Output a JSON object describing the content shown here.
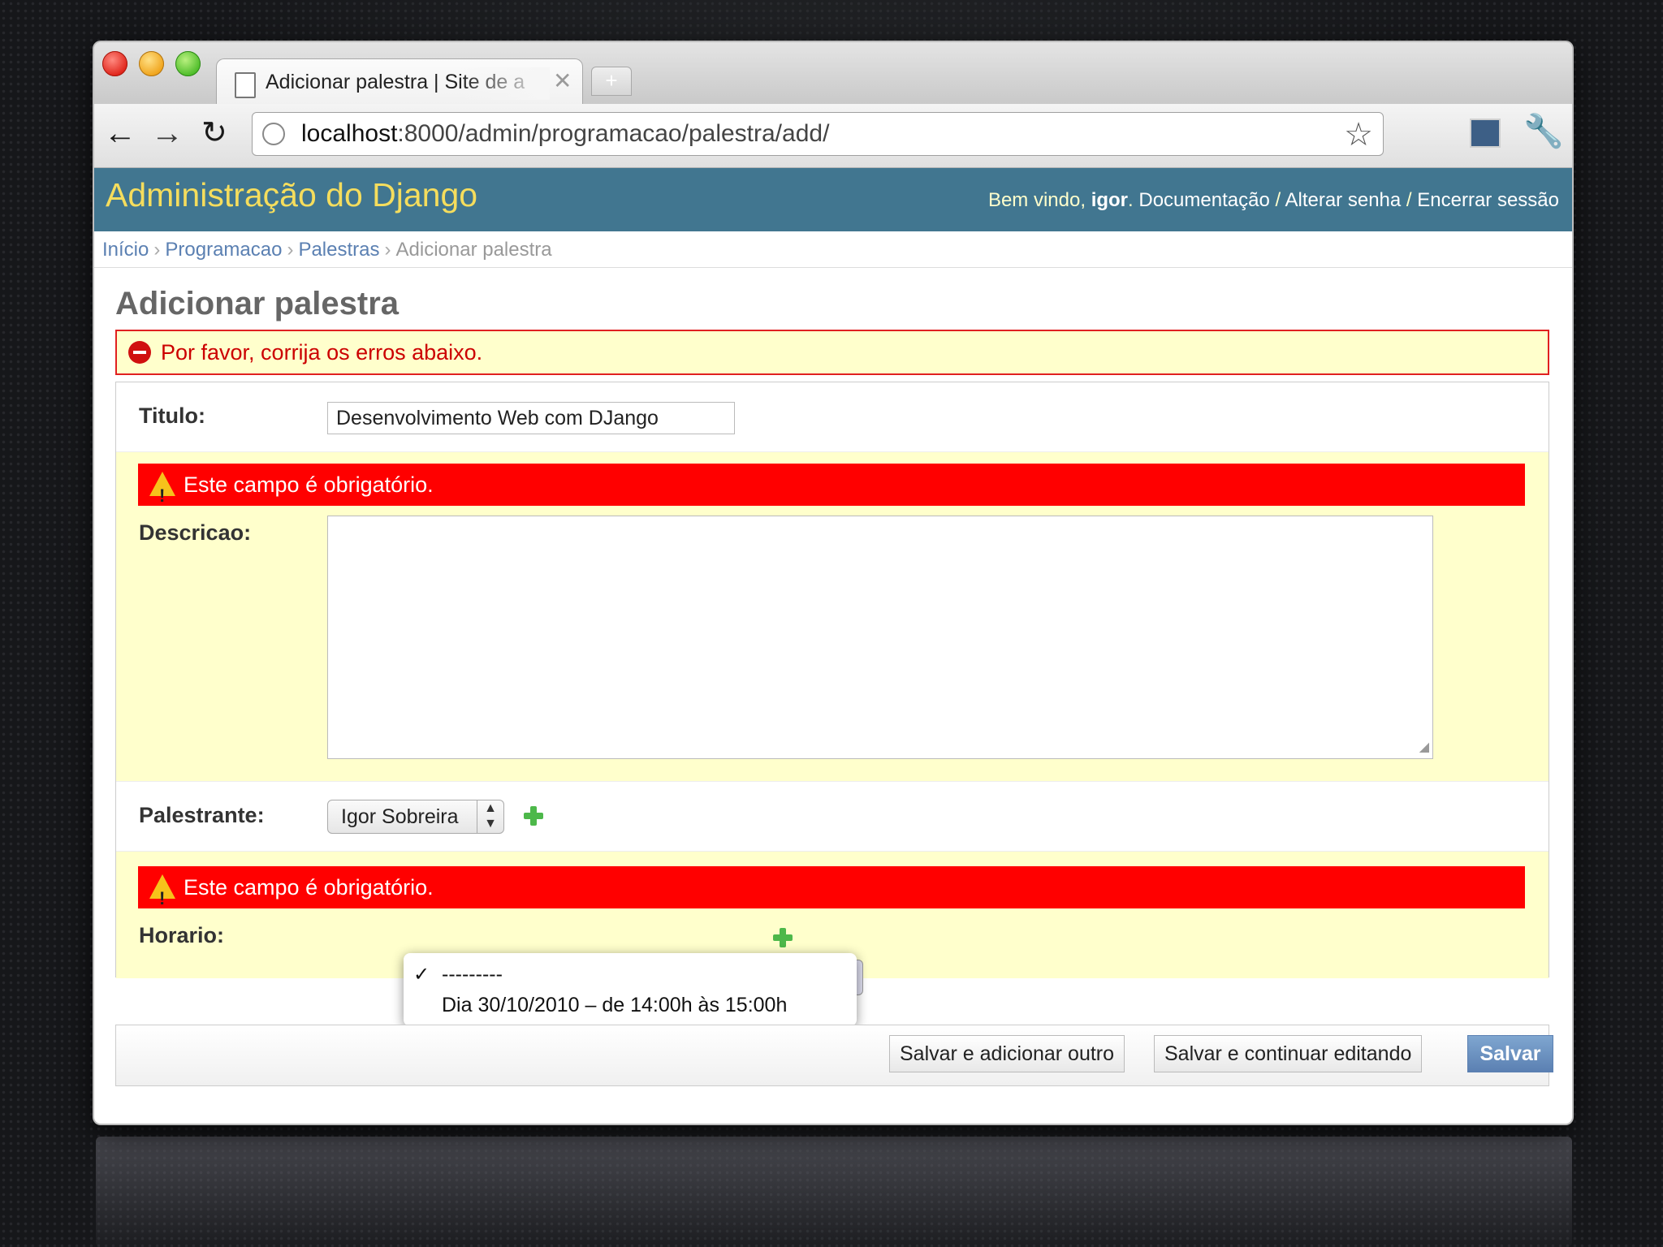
{
  "browser": {
    "tab_title": "Adicionar palestra | Site de a",
    "tab_close": "✕",
    "new_tab": "+",
    "url_host": "localhost",
    "url_rest": ":8000/admin/programacao/palestra/add/"
  },
  "header": {
    "brand": "Administração do Django",
    "welcome": "Bem vindo, ",
    "username": "igor",
    "period": ".",
    "docs": "Documentação",
    "sep": " / ",
    "change_password": "Alterar senha",
    "logout": "Encerrar sessão"
  },
  "breadcrumbs": {
    "home": "Início",
    "app": "Programacao",
    "model": "Palestras",
    "current": "Adicionar palestra",
    "sep": "›"
  },
  "page": {
    "title": "Adicionar palestra",
    "error_note": "Por favor, corrija os erros abaixo."
  },
  "form": {
    "titulo_label": "Titulo:",
    "titulo_value": "Desenvolvimento Web com DJango",
    "descricao_error": "Este campo é obrigatório.",
    "descricao_label": "Descricao:",
    "palestrante_label": "Palestrante:",
    "palestrante_value": "Igor Sobreira",
    "horario_error": "Este campo é obrigatório.",
    "horario_label": "Horario:",
    "horario_options": [
      "---------",
      "Dia 30/10/2010 – de 14:00h às 15:00h"
    ]
  },
  "buttons": {
    "save_add_another": "Salvar e adicionar outro",
    "save_continue": "Salvar e continuar editando",
    "save": "Salvar"
  },
  "colors": {
    "header_bg": "#417690",
    "brand": "#f5dd5d",
    "error_red": "#ff0000",
    "link": "#5b80b2"
  }
}
